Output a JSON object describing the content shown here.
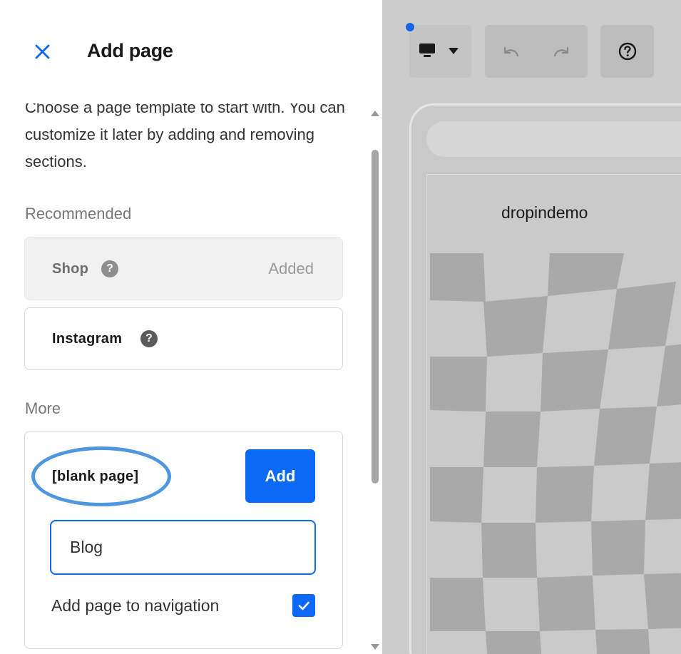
{
  "panel": {
    "title": "Add page",
    "intro": "Choose a page template to start with. You can customize it later by adding and removing sections.",
    "recommended_label": "Recommended",
    "recommended": [
      {
        "name": "Shop",
        "status": "Added"
      },
      {
        "name": "Instagram",
        "status": ""
      }
    ],
    "more_label": "More",
    "blank": {
      "name": "[blank page]",
      "add_label": "Add",
      "input_value": "Blog",
      "nav_label": "Add page to navigation",
      "nav_checked": true
    }
  },
  "help_glyph": "?",
  "preview": {
    "site_name": "dropindemo"
  },
  "colors": {
    "accent": "#0a6af5",
    "highlight": "#4e96e0",
    "preview_bg": "#cccccc"
  },
  "icons": [
    "close-icon",
    "help-icon",
    "desktop-icon",
    "caret-down-icon",
    "undo-icon",
    "redo-icon",
    "question-circle-icon",
    "check-icon"
  ]
}
